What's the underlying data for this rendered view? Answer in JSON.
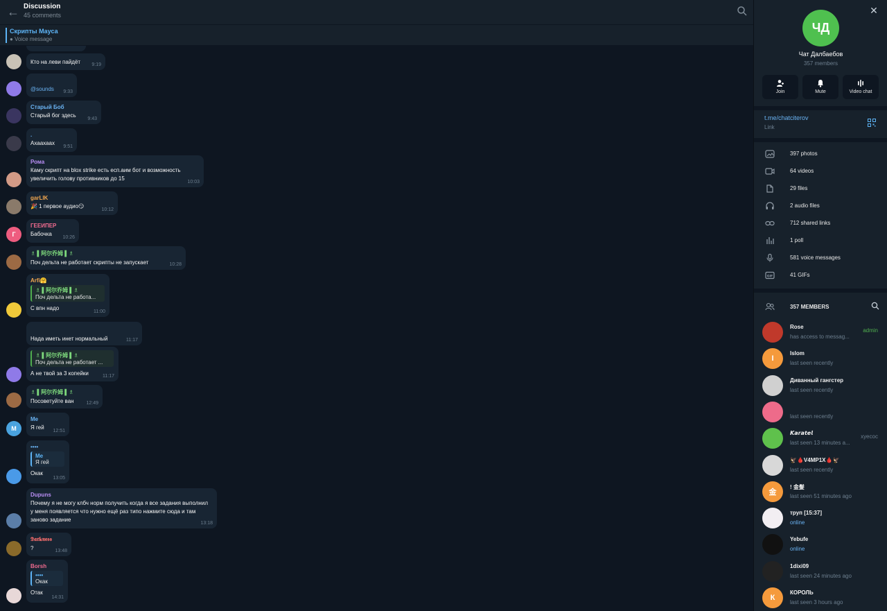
{
  "header": {
    "title": "Discussion",
    "subtitle": "45 comments"
  },
  "pinned": {
    "title": "Скрипты Мауса",
    "subtitle": "● Voice message"
  },
  "messages": [
    {
      "sender": "",
      "text": "Кто на леви пайдёт",
      "time": "9:19",
      "avatar_color": "#c9c2b6",
      "avatar_letter": ""
    },
    {
      "sender": "",
      "text": "@sounds",
      "time": "9:33",
      "avatar_color": "#8f7ae8",
      "avatar_letter": ""
    },
    {
      "sender": "Старый Боб",
      "sender_color": "#6ab3f3",
      "text": "Старый бог здесь",
      "time": "9:43",
      "avatar_color": "#3a3560",
      "avatar_letter": ""
    },
    {
      "sender": ".",
      "sender_color": "#6ab3f3",
      "text": "Ахаахаах",
      "time": "9:51",
      "avatar_color": "#3a3a4a",
      "avatar_letter": ""
    },
    {
      "sender": "Рома",
      "sender_color": "#b98ef5",
      "text": "Каму скрипт на blox strike есть есп.аим бот и возможность увеличить голову противников до 15",
      "time": "10:03",
      "avatar_color": "#d29a86",
      "avatar_letter": ""
    },
    {
      "sender": "garLIK",
      "sender_color": "#f2a74f",
      "text": "🎉 1 первое аудио😏",
      "time": "10:12",
      "avatar_color": "#8a7a6a",
      "avatar_letter": ""
    },
    {
      "sender": "ГЕЕИПЕР",
      "sender_color": "#f06b8f",
      "text": "Бабочка",
      "time": "10:26",
      "avatar_color": "#ee5c7f",
      "avatar_letter": "Г"
    },
    {
      "sender": "♗ ▌阿尔乔姆 ▌♗",
      "sender_color": "#7dd87c",
      "text": "Поч дельта не работает скрипты не запускает",
      "time": "10:28",
      "avatar_color": "#9c6a44",
      "avatar_letter": ""
    },
    {
      "sender": "Arfi🤗",
      "sender_color": "#f2a74f",
      "reply_name": "♗ ▌阿尔乔姆 ▌♗",
      "reply_text": "Поч дельта не работа...",
      "text": "С впн надо",
      "time": "11:00",
      "avatar_color": "#f0c93a",
      "avatar_letter": ""
    },
    {
      "sender": "",
      "text": "Нада иметь инет нормальный",
      "time": "11:17",
      "avatar_color": "",
      "avatar_letter": ""
    },
    {
      "sender": "",
      "reply_name": "♗ ▌阿尔乔姆 ▌♗",
      "reply_text": "Поч дельта не работает ...",
      "text": "А не твой за 3 копейки",
      "time": "11:17",
      "avatar_color": "#8f7ae8",
      "avatar_letter": ""
    },
    {
      "sender": "♗ ▌阿尔乔姆 ▌♗",
      "sender_color": "#7dd87c",
      "text": "Посоветуйте ван",
      "time": "12:49",
      "avatar_color": "#9c6a44",
      "avatar_letter": ""
    },
    {
      "sender": "Me",
      "sender_color": "#6ab3f3",
      "text": "Я гей",
      "time": "12:51",
      "avatar_color": "#4aa3df",
      "avatar_letter": "M"
    },
    {
      "sender": "••••",
      "sender_color": "#6ab3f3",
      "reply_name": "Me",
      "reply_text": "Я гей",
      "text": "Окак",
      "time": "13:05",
      "avatar_color": "#4a9ae8",
      "avatar_letter": ""
    },
    {
      "sender": "Dupuns",
      "sender_color": "#b98ef5",
      "text": "Почему я не могу клбч норм получить когда я все задания выполнил у меня появляется что нужно ещё раз типо нажмите сюда и там заново задание",
      "time": "13:18",
      "avatar_color": "#5b7ea8",
      "avatar_letter": ""
    },
    {
      "sender": "𝕯𝖆𝖗𝖐𝖓𝖊𝖘𝖘",
      "sender_color": "#f06b6b",
      "text": "?",
      "time": "13:48",
      "avatar_color": "#8a6a2a",
      "avatar_letter": ""
    },
    {
      "sender": "Borsh",
      "sender_color": "#f06b8f",
      "reply_name": "••••",
      "reply_text": "Окак",
      "text": "Отак",
      "time": "14:31",
      "avatar_color": "#e8d8d8",
      "avatar_letter": ""
    }
  ],
  "info": {
    "avatar_letters": "ЧД",
    "name": "Чат Далбаебов",
    "members": "357 members",
    "actions": [
      {
        "label": "Join",
        "icon": "add-user-icon"
      },
      {
        "label": "Mute",
        "icon": "bell-icon"
      },
      {
        "label": "Video chat",
        "icon": "voice-chat-icon"
      }
    ],
    "link": {
      "url": "t.me/chatciterov",
      "label": "Link"
    },
    "media": [
      {
        "label": "397 photos",
        "icon": "photo-icon"
      },
      {
        "label": "64 videos",
        "icon": "video-icon"
      },
      {
        "label": "29 files",
        "icon": "file-icon"
      },
      {
        "label": "2 audio files",
        "icon": "headphones-icon"
      },
      {
        "label": "712 shared links",
        "icon": "link-icon"
      },
      {
        "label": "1 poll",
        "icon": "poll-icon"
      },
      {
        "label": "581 voice messages",
        "icon": "microphone-icon"
      },
      {
        "label": "41 GIFs",
        "icon": "gif-icon"
      }
    ],
    "members_header": "357 MEMBERS",
    "member_list": [
      {
        "name": "Rose",
        "status": "has access to messag...",
        "badge": "admin",
        "color": "#c0392b",
        "letter": "",
        "online": false
      },
      {
        "name": "Islom",
        "status": "last seen recently",
        "badge": "",
        "color": "#f59a3c",
        "letter": "I",
        "online": false
      },
      {
        "name": "Диванный гангстер",
        "status": "last seen recently",
        "badge": "",
        "color": "#d0d0d0",
        "letter": "",
        "online": false
      },
      {
        "name": "",
        "status": "last seen recently",
        "badge": "",
        "color": "#ee6b8a",
        "letter": "",
        "online": false
      },
      {
        "name": "𝙆𝙖𝙧𝙖𝙩𝙚𝙡",
        "status": "last seen 13 minutes a...",
        "badge": "хуесос",
        "color": "#5fc14c",
        "letter": "",
        "online": false
      },
      {
        "name": "🦅🩸V4MP1X🩸🦅",
        "status": "last seen recently",
        "badge": "",
        "color": "#d8d8d8",
        "letter": "",
        "online": false
      },
      {
        "name": "! 金髮",
        "status": "last seen 51 minutes ago",
        "badge": "",
        "color": "#f59a3c",
        "letter": "金",
        "online": false
      },
      {
        "name": "труп [15:37]",
        "status": "online",
        "badge": "",
        "color": "#f2eef2",
        "letter": "",
        "online": true
      },
      {
        "name": "Yebufe",
        "status": "online",
        "badge": "",
        "color": "#111111",
        "letter": "",
        "online": true
      },
      {
        "name": "1dixi09",
        "status": "last seen 24 minutes ago",
        "badge": "",
        "color": "#222222",
        "letter": "",
        "online": false
      },
      {
        "name": "КОРОЛЬ",
        "status": "last seen 3 hours ago",
        "badge": "",
        "color": "#f59a3c",
        "letter": "К",
        "online": false
      }
    ]
  }
}
